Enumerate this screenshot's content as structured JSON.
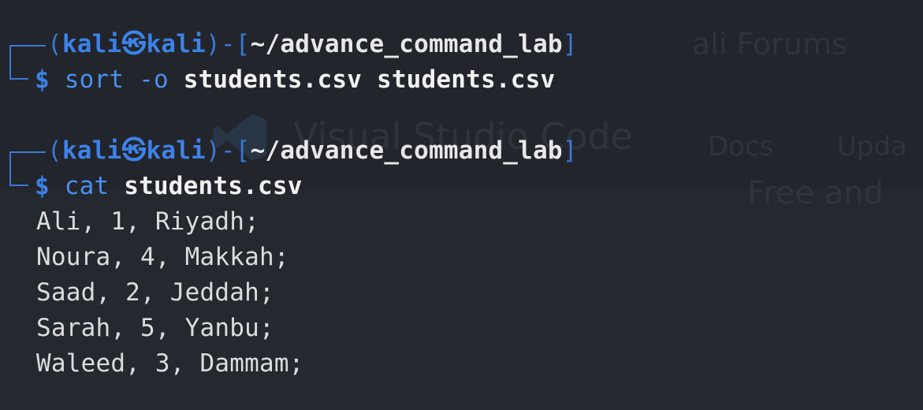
{
  "background_ghost": {
    "forums": "ali Forums",
    "vscode": "Visual Studio Code",
    "docs": "Docs",
    "updates": "Upda",
    "tagline": "Free and"
  },
  "blocks": [
    {
      "prompt": {
        "open": "(",
        "user": "kali",
        "at": "㉿",
        "host": "kali",
        "close": ")-[",
        "path": "~/advance_command_lab",
        "end": "]"
      },
      "dollar": "$",
      "command": "sort",
      "flag": "-o",
      "arg1": "students.csv",
      "arg2": "students.csv"
    },
    {
      "prompt": {
        "open": "(",
        "user": "kali",
        "at": "㉿",
        "host": "kali",
        "close": ")-[",
        "path": "~/advance_command_lab",
        "end": "]"
      },
      "dollar": "$",
      "command": "cat",
      "arg1": "students.csv"
    }
  ],
  "output_lines": [
    "Ali, 1, Riyadh;",
    "Noura, 4, Makkah;",
    "Saad, 2, Jeddah;",
    "Sarah, 5, Yanbu;",
    "Waleed, 3, Dammam;"
  ],
  "colors": {
    "background": "#24282f",
    "prompt_blue": "#3c82e8",
    "path_white": "#e8e8e8",
    "output_text": "#dcdcdc"
  }
}
